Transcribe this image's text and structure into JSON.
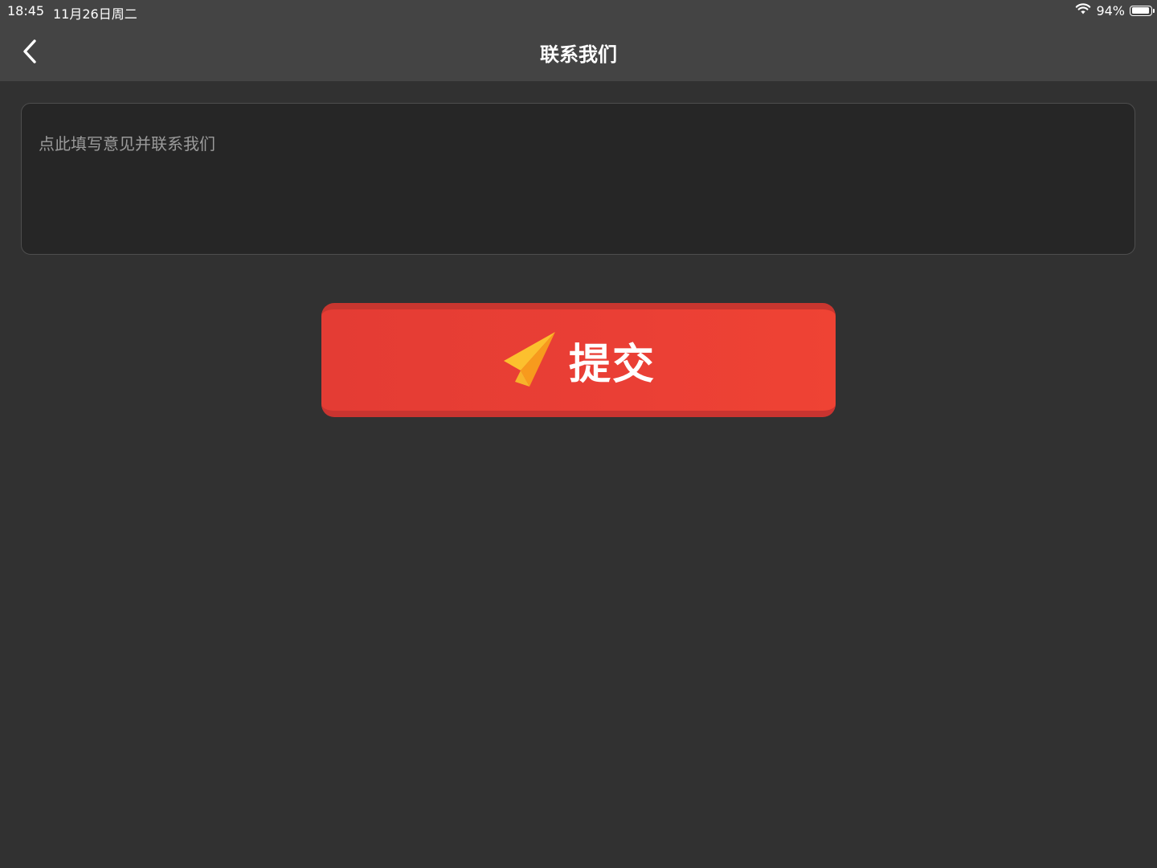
{
  "status_bar": {
    "time": "18:45",
    "date": "11月26日周二",
    "battery": "94%",
    "battery_level": 0.94
  },
  "nav": {
    "title": "联系我们"
  },
  "feedback": {
    "placeholder": "点此填写意见并联系我们",
    "value": ""
  },
  "submit": {
    "label": "提交"
  },
  "colors": {
    "background": "#313131",
    "nav_bar": "#444444",
    "input_background": "#262626",
    "button": "#e93e34",
    "icon_yellow": "#fcc02e",
    "icon_orange": "#f79a1d"
  },
  "icons": [
    "back-chevron-icon",
    "wifi-icon",
    "battery-icon",
    "paper-plane-icon"
  ]
}
